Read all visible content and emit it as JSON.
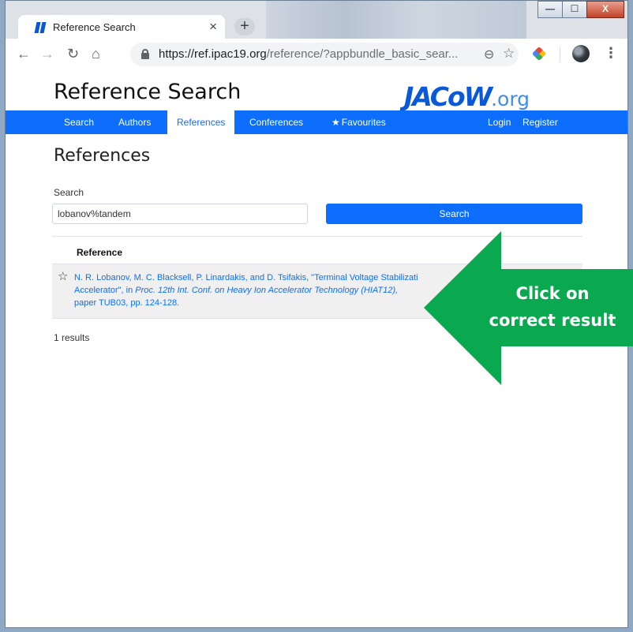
{
  "browser": {
    "tab_title": "Reference Search",
    "tab_close": "×",
    "new_tab": "+",
    "url_host": "https://ref.ipac19.org",
    "url_path": "/reference/?appbundle_basic_sear...",
    "window_controls": {
      "minimize": "—",
      "maximize": "☐",
      "close": "X"
    },
    "icons": [
      "back-icon",
      "forward-icon",
      "reload-icon",
      "home-icon",
      "lock-icon",
      "zoom-icon",
      "bookmark-star-icon",
      "extension-icon",
      "profile-avatar",
      "menu-icon"
    ]
  },
  "site": {
    "title": "Reference Search",
    "logo_main": "JACoW",
    "logo_suffix": ".org",
    "brand_color": "#0d6efd"
  },
  "nav": {
    "search": "Search",
    "authors": "Authors",
    "references": "References",
    "conferences": "Conferences",
    "favourites": "Favourites",
    "login": "Login",
    "register": "Register",
    "active": "References"
  },
  "main": {
    "heading": "References",
    "search_label": "Search",
    "search_value": "lobanov%tandem",
    "search_button": "Search",
    "column_header": "Reference",
    "result": {
      "authors_title": "N. R. Lobanov, M. C. Blacksell, P. Linardakis, and D. Tsifakis, \"Terminal Voltage Stabilizati",
      "line2_pre": "Accelerator\", in ",
      "line2_em": "Proc. 12th Int. Conf. on Heavy Ion Accelerator Technology (HIAT12),",
      "line3": "paper TUB03, pp. 124-128."
    },
    "result_count": "1 results"
  },
  "annotation": {
    "line1": "Click on",
    "line2": "correct result",
    "color": "#0aa84f"
  }
}
